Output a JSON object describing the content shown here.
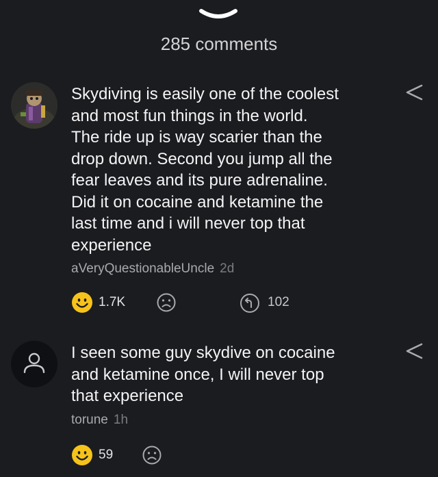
{
  "header": {
    "comments_count_label": "285 comments"
  },
  "comments": [
    {
      "text": "Skydiving is easily one of the coolest\nand most fun things in the world.\nThe ride up is way scarier than the\ndrop down. Second you jump all the\nfear leaves and its pure adrenaline.\nDid it on cocaine and ketamine the\nlast time and i will never top that\nexperience",
      "author": "aVeryQuestionableUncle",
      "time": "2d",
      "likes": "1.7K",
      "replies": "102",
      "avatar_icon": "character-avatar"
    },
    {
      "text": "I seen some guy skydive on cocaine\nand ketamine once, I will never top\nthat experience",
      "author": "torune",
      "time": "1h",
      "likes": "59",
      "avatar_icon": "default-user-avatar"
    }
  ],
  "icons": {
    "collapse": "chevron-down-icon",
    "share": "share-icon",
    "like": "smile-emoji-icon",
    "dislike": "frown-icon",
    "reply": "reply-icon"
  },
  "colors": {
    "background": "#1b1c20",
    "emoji_yellow": "#f6c31a",
    "muted_text": "#a9aaad"
  }
}
